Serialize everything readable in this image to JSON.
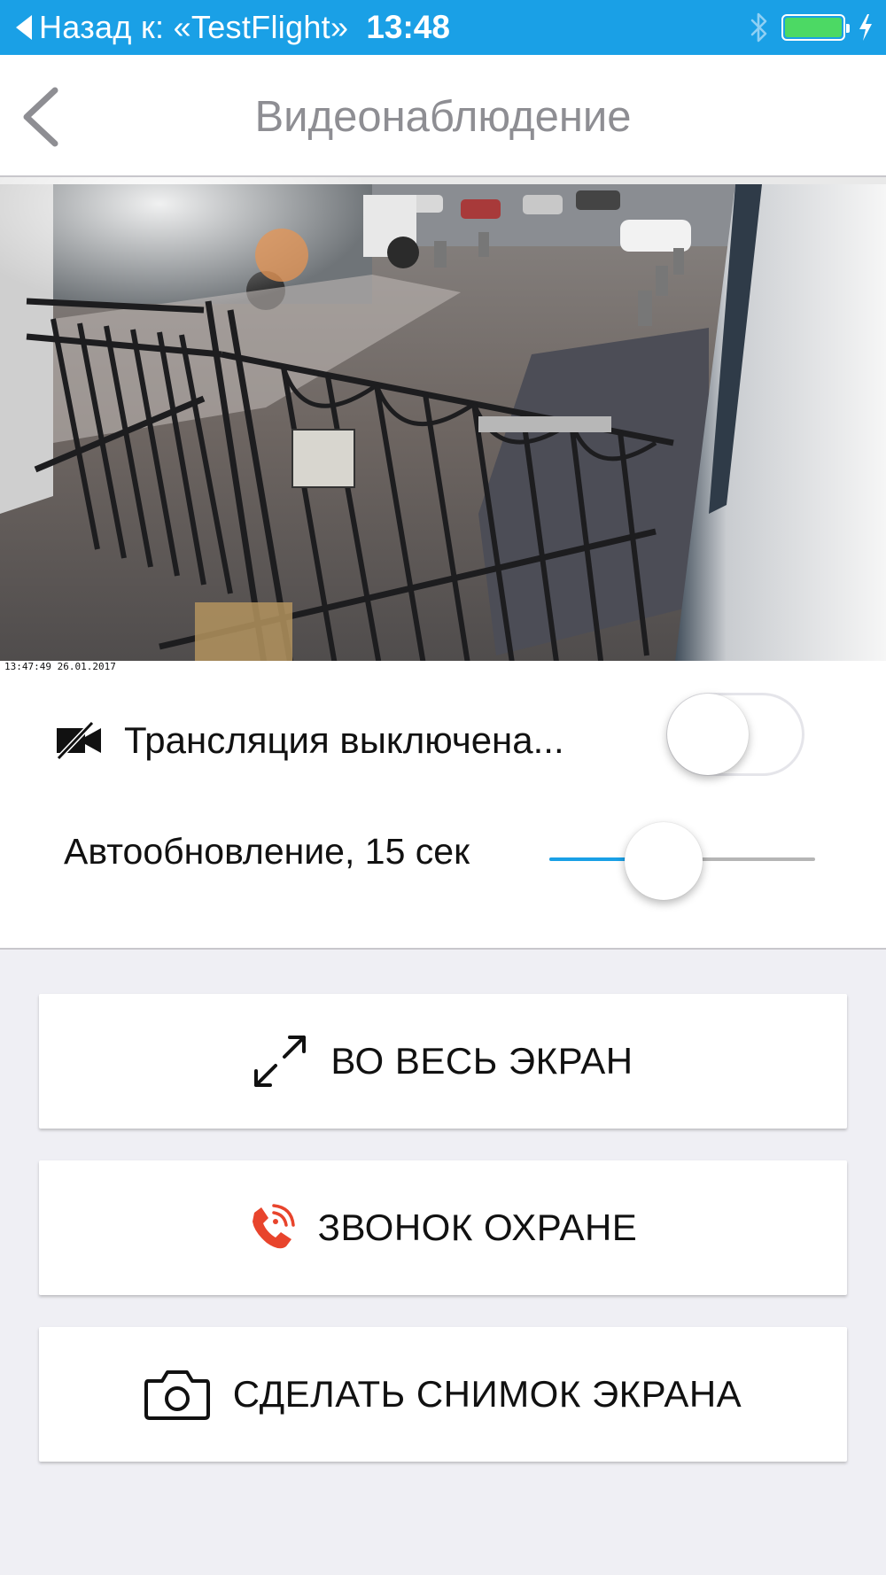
{
  "status_bar": {
    "back_label": "Назад к: «TestFlight»",
    "time": "13:48",
    "bluetooth_icon": "bluetooth-icon",
    "battery_icon": "battery-charging-icon",
    "accent_color": "#1aa0e6"
  },
  "nav": {
    "back_icon": "chevron-left-icon",
    "title": "Видеонаблюдение"
  },
  "camera": {
    "timestamp": "13:47:49 26.01.2017"
  },
  "stream": {
    "icon": "video-off-icon",
    "label": "Трансляция выключена...",
    "enabled": false
  },
  "auto_refresh": {
    "label": "Автообновление, 15 сек",
    "slider_fraction": 0.43
  },
  "buttons": {
    "fullscreen": {
      "label": "ВО ВЕСЬ ЭКРАН",
      "icon": "expand-arrows-icon"
    },
    "call_security": {
      "label": "ЗВОНОК ОХРАНЕ",
      "icon": "phone-ringing-icon",
      "icon_color": "#e8442c"
    },
    "screenshot": {
      "label": "СДЕЛАТЬ СНИМОК ЭКРАНА",
      "icon": "camera-icon"
    }
  }
}
